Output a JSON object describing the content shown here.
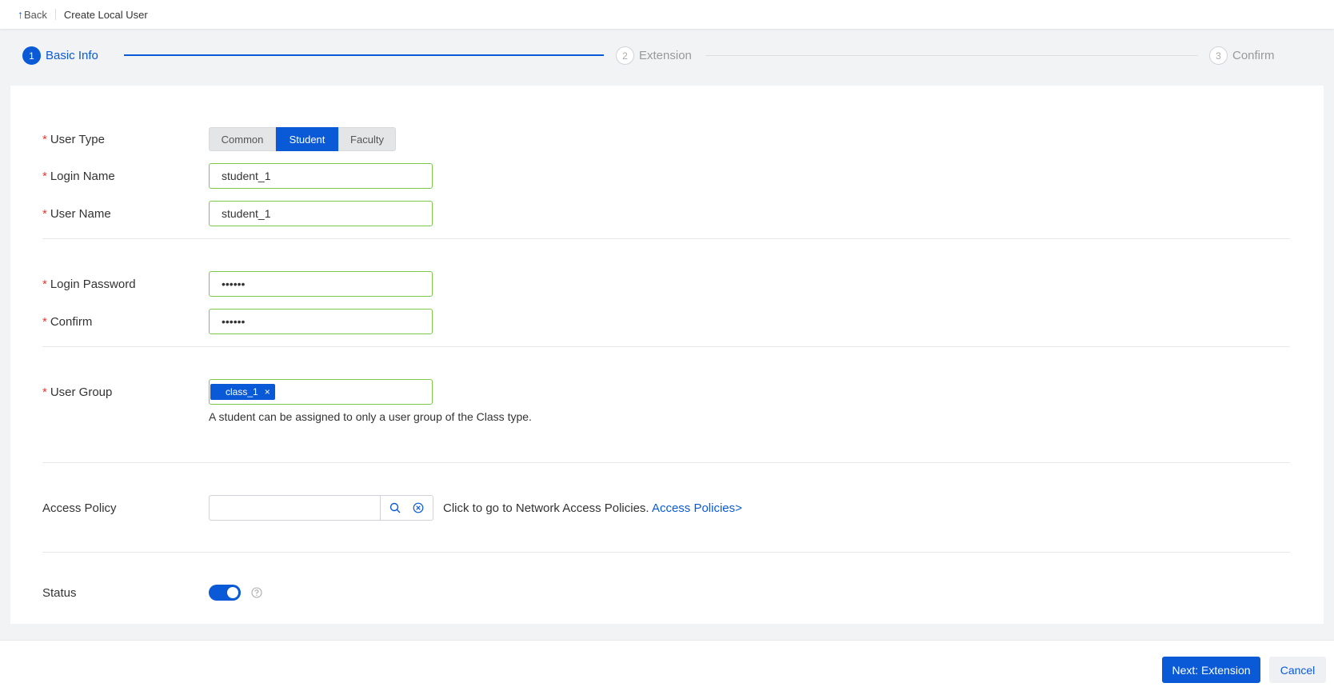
{
  "header": {
    "back_label": "Back",
    "page_title": "Create Local User"
  },
  "stepper": {
    "steps": [
      {
        "number": "1",
        "label": "Basic Info"
      },
      {
        "number": "2",
        "label": "Extension"
      },
      {
        "number": "3",
        "label": "Confirm"
      }
    ]
  },
  "form": {
    "user_type": {
      "label": "User Type",
      "options": [
        "Common",
        "Student",
        "Faculty"
      ],
      "selected": "Student"
    },
    "login_name": {
      "label": "Login Name",
      "value": "student_1"
    },
    "user_name": {
      "label": "User Name",
      "value": "student_1"
    },
    "login_password": {
      "label": "Login Password",
      "value": "••••••"
    },
    "confirm": {
      "label": "Confirm",
      "value": "••••••"
    },
    "user_group": {
      "label": "User Group",
      "tag": "class_1",
      "tag_remove": "×",
      "hint": "A student can be assigned to only a user group of the Class type."
    },
    "access_policy": {
      "label": "Access Policy",
      "value": "",
      "description": "Click to go to Network Access Policies.",
      "link_label": "Access Policies>"
    },
    "status": {
      "label": "Status",
      "enabled": true
    }
  },
  "footer": {
    "next_label": "Next: Extension",
    "cancel_label": "Cancel"
  },
  "colors": {
    "accent": "#0a5ad8",
    "valid_border": "#7cc84a",
    "required": "#e53935"
  }
}
